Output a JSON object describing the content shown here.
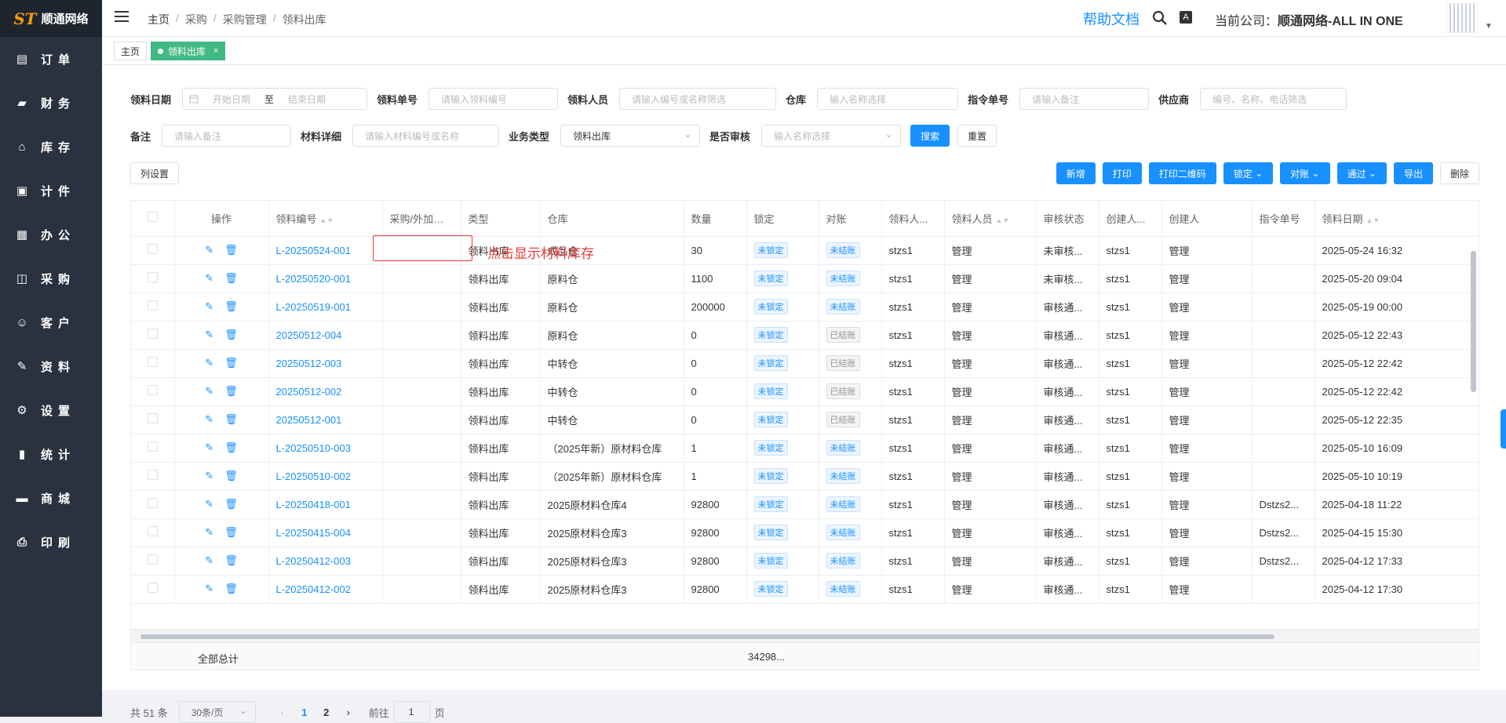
{
  "logo": {
    "mark": "ST",
    "name": "顺通网络"
  },
  "nav": [
    {
      "label": "订单",
      "icon": "order-icon",
      "glyph": "▤"
    },
    {
      "label": "财务",
      "icon": "wallet-icon",
      "glyph": "▰"
    },
    {
      "label": "库存",
      "icon": "home-icon",
      "glyph": "⌂"
    },
    {
      "label": "计件",
      "icon": "clipboard-icon",
      "glyph": "▣"
    },
    {
      "label": "办公",
      "icon": "calendar-icon",
      "glyph": "▦"
    },
    {
      "label": "采购",
      "icon": "bag-icon",
      "glyph": "◫"
    },
    {
      "label": "客户",
      "icon": "user-icon",
      "glyph": "☺"
    },
    {
      "label": "资料",
      "icon": "edit-icon",
      "glyph": "✎"
    },
    {
      "label": "设置",
      "icon": "gear-icon",
      "glyph": "⚙"
    },
    {
      "label": "统计",
      "icon": "bar-chart-icon",
      "glyph": "▮"
    },
    {
      "label": "商城",
      "icon": "shop-icon",
      "glyph": "▬"
    },
    {
      "label": "印刷",
      "icon": "printer-icon",
      "glyph": "⎙"
    }
  ],
  "breadcrumb": [
    "主页",
    "采购",
    "采购管理",
    "领料出库"
  ],
  "header": {
    "help": "帮助文档",
    "company_label": "当前公司：",
    "company_name": "顺通网络-ALL IN ONE",
    "font_icon": "A"
  },
  "tabs": {
    "home": "主页",
    "active": "领料出库",
    "close": "×"
  },
  "filters": {
    "date_label": "领料日期",
    "date_start": "开始日期",
    "date_to": "至",
    "date_end": "结束日期",
    "no_label": "领料单号",
    "no_placeholder": "请输入领料编号",
    "person_label": "领料人员",
    "person_placeholder": "请输入编号或名称筛选",
    "warehouse_label": "仓库",
    "warehouse_placeholder": "输入名称选择",
    "cmd_label": "指令单号",
    "cmd_placeholder": "请输入备注",
    "supplier_label": "供应商",
    "supplier_placeholder": "编号、名称、电话筛选",
    "remark_label": "备注",
    "remark_placeholder": "请输入备注",
    "material_label": "材料详细",
    "material_placeholder": "请输入材料编号或名称",
    "biz_label": "业务类型",
    "biz_value": "领料出库",
    "audit_label": "是否审核",
    "audit_placeholder": "输入名称选择",
    "search": "搜索",
    "reset": "重置"
  },
  "toolbar": {
    "col_settings": "列设置",
    "add": "新增",
    "print": "打印",
    "print_qr": "打印二维码",
    "lock": "锁定",
    "reconcile": "对账",
    "approve": "通过",
    "export": "导出",
    "delete": "删除"
  },
  "columns": [
    "操作",
    "领料编号",
    "采购/外加工单",
    "类型",
    "仓库",
    "数量",
    "锁定",
    "对账",
    "领料人...",
    "领料人员",
    "审核状态",
    "创建人...",
    "创建人",
    "指令单号",
    "领料日期"
  ],
  "rows": [
    {
      "no": "L-20250524-001",
      "type": "领料出库",
      "wh": "成品仓",
      "qty": "30",
      "lock": "未锁定",
      "rec": "未结账",
      "p1": "stzs1",
      "p2": "管理",
      "audit": "未审核...",
      "c1": "stzs1",
      "c2": "管理",
      "cmd": "",
      "date": "2025-05-24 16:32"
    },
    {
      "no": "L-20250520-001",
      "type": "领料出库",
      "wh": "原料仓",
      "qty": "1100",
      "lock": "未锁定",
      "rec": "未结账",
      "p1": "stzs1",
      "p2": "管理",
      "audit": "未审核...",
      "c1": "stzs1",
      "c2": "管理",
      "cmd": "",
      "date": "2025-05-20 09:04"
    },
    {
      "no": "L-20250519-001",
      "type": "领料出库",
      "wh": "原料仓",
      "qty": "200000",
      "lock": "未锁定",
      "rec": "未结账",
      "p1": "stzs1",
      "p2": "管理",
      "audit": "审核通...",
      "c1": "stzs1",
      "c2": "管理",
      "cmd": "",
      "date": "2025-05-19 00:00"
    },
    {
      "no": "20250512-004",
      "type": "领料出库",
      "wh": "原料仓",
      "qty": "0",
      "lock": "未锁定",
      "rec": "已结账",
      "p1": "stzs1",
      "p2": "管理",
      "audit": "审核通...",
      "c1": "stzs1",
      "c2": "管理",
      "cmd": "",
      "date": "2025-05-12 22:43"
    },
    {
      "no": "20250512-003",
      "type": "领料出库",
      "wh": "中转仓",
      "qty": "0",
      "lock": "未锁定",
      "rec": "已结账",
      "p1": "stzs1",
      "p2": "管理",
      "audit": "审核通...",
      "c1": "stzs1",
      "c2": "管理",
      "cmd": "",
      "date": "2025-05-12 22:42"
    },
    {
      "no": "20250512-002",
      "type": "领料出库",
      "wh": "中转仓",
      "qty": "0",
      "lock": "未锁定",
      "rec": "已结账",
      "p1": "stzs1",
      "p2": "管理",
      "audit": "审核通...",
      "c1": "stzs1",
      "c2": "管理",
      "cmd": "",
      "date": "2025-05-12 22:42"
    },
    {
      "no": "20250512-001",
      "type": "领料出库",
      "wh": "中转仓",
      "qty": "0",
      "lock": "未锁定",
      "rec": "已结账",
      "p1": "stzs1",
      "p2": "管理",
      "audit": "审核通...",
      "c1": "stzs1",
      "c2": "管理",
      "cmd": "",
      "date": "2025-05-12 22:35"
    },
    {
      "no": "L-20250510-003",
      "type": "领料出库",
      "wh": "（2025年新）原材料仓库",
      "qty": "1",
      "lock": "未锁定",
      "rec": "未结账",
      "p1": "stzs1",
      "p2": "管理",
      "audit": "审核通...",
      "c1": "stzs1",
      "c2": "管理",
      "cmd": "",
      "date": "2025-05-10 16:09"
    },
    {
      "no": "L-20250510-002",
      "type": "领料出库",
      "wh": "（2025年新）原材料仓库",
      "qty": "1",
      "lock": "未锁定",
      "rec": "未结账",
      "p1": "stzs1",
      "p2": "管理",
      "audit": "审核通...",
      "c1": "stzs1",
      "c2": "管理",
      "cmd": "",
      "date": "2025-05-10 10:19"
    },
    {
      "no": "L-20250418-001",
      "type": "领料出库",
      "wh": "2025原材料仓库4",
      "qty": "92800",
      "lock": "未锁定",
      "rec": "未结账",
      "p1": "stzs1",
      "p2": "管理",
      "audit": "审核通...",
      "c1": "stzs1",
      "c2": "管理",
      "cmd": "Dstzs2...",
      "date": "2025-04-18 11:22"
    },
    {
      "no": "L-20250415-004",
      "type": "领料出库",
      "wh": "2025原材料仓库3",
      "qty": "92800",
      "lock": "未锁定",
      "rec": "未结账",
      "p1": "stzs1",
      "p2": "管理",
      "audit": "审核通...",
      "c1": "stzs1",
      "c2": "管理",
      "cmd": "Dstzs2...",
      "date": "2025-04-15 15:30"
    },
    {
      "no": "L-20250412-003",
      "type": "领料出库",
      "wh": "2025原材料仓库3",
      "qty": "92800",
      "lock": "未锁定",
      "rec": "未结账",
      "p1": "stzs1",
      "p2": "管理",
      "audit": "审核通...",
      "c1": "stzs1",
      "c2": "管理",
      "cmd": "Dstzs2...",
      "date": "2025-04-12 17:33"
    },
    {
      "no": "L-20250412-002",
      "type": "领料出库",
      "wh": "2025原材料仓库3",
      "qty": "92800",
      "lock": "未锁定",
      "rec": "未结账",
      "p1": "stzs1",
      "p2": "管理",
      "audit": "审核通...",
      "c1": "stzs1",
      "c2": "管理",
      "cmd": "",
      "date": "2025-04-12 17:30"
    }
  ],
  "total": {
    "label": "全部总计",
    "qty": "34298..."
  },
  "pager": {
    "total": "共 51 条",
    "size": "30条/页",
    "pages": [
      "1",
      "2"
    ],
    "goto": "前往",
    "goto_value": "1",
    "page_unit": "页"
  },
  "annotation": "点击显示材料库存"
}
